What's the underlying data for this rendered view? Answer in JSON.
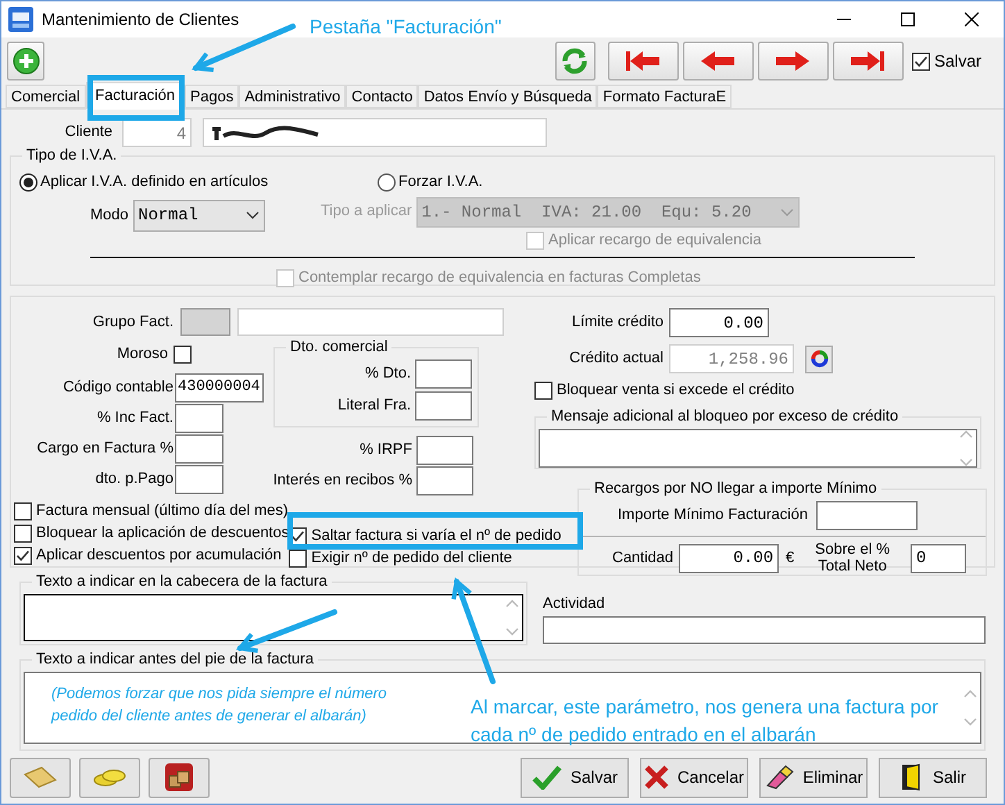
{
  "window": {
    "title": "Mantenimiento de Clientes"
  },
  "toolbar": {
    "salvar": {
      "label": "Salvar",
      "checked": true
    }
  },
  "tabs": [
    {
      "label": "Comercial",
      "selected": false
    },
    {
      "label": "Facturación",
      "selected": true
    },
    {
      "label": "Pagos",
      "selected": false
    },
    {
      "label": "Administrativo",
      "selected": false
    },
    {
      "label": "Contacto",
      "selected": false
    },
    {
      "label": "Datos Envío y Búsqueda",
      "selected": false
    },
    {
      "label": "Formato FacturaE",
      "selected": false
    }
  ],
  "cliente": {
    "label": "Cliente",
    "code": "4"
  },
  "iva": {
    "title": "Tipo de I.V.A.",
    "options": [
      {
        "label": "Aplicar I.V.A. definido en artículos",
        "selected": true
      },
      {
        "label": "Forzar I.V.A.",
        "selected": false
      }
    ],
    "modo": {
      "label": "Modo",
      "value": "Normal"
    },
    "tipo": {
      "label": "Tipo a aplicar",
      "value": "1.- Normal  IVA: 21.00  Equ: 5.20",
      "disabled": true
    },
    "recargo": {
      "label": "Aplicar recargo de equivalencia",
      "checked": false,
      "disabled": true
    },
    "contemplar": {
      "label": "Contemplar recargo de equivalencia en facturas Completas",
      "checked": false,
      "disabled": true
    }
  },
  "billing": {
    "grupo": {
      "label": "Grupo Fact."
    },
    "moroso": {
      "label": "Moroso",
      "checked": false
    },
    "codigo": {
      "label": "Código contable",
      "value": "430000004"
    },
    "inc": {
      "label": "% Inc Fact."
    },
    "cargo": {
      "label": "Cargo en Factura %"
    },
    "pago": {
      "label": "dto. p.Pago"
    },
    "dto_group": {
      "title": "Dto. comercial",
      "fields": [
        {
          "label": "% Dto."
        },
        {
          "label": "Literal Fra."
        }
      ]
    },
    "irpf": {
      "label": "% IRPF"
    },
    "interes": {
      "label": "Interés en recibos %"
    },
    "checks_left": [
      {
        "label": "Factura mensual (último día del mes)",
        "checked": false
      },
      {
        "label": "Bloquear la aplicación de descuentos",
        "checked": false
      },
      {
        "label": "Aplicar descuentos por acumulación",
        "checked": true
      }
    ],
    "checks_mid": [
      {
        "label": "Saltar factura si varía el nº de pedido",
        "checked": true
      },
      {
        "label": "Exigir nº de pedido del cliente",
        "checked": false
      }
    ]
  },
  "credit": {
    "limite": {
      "label": "Límite crédito",
      "value": "0.00"
    },
    "actual": {
      "label": "Crédito actual",
      "value": "1,258.96",
      "disabled": true
    },
    "bloquear": {
      "label": "Bloquear venta si excede el crédito",
      "checked": false
    },
    "mensaje": {
      "title": "Mensaje adicional al bloqueo por exceso de crédito"
    }
  },
  "recargos": {
    "title": "Recargos por NO llegar a importe Mínimo",
    "importe": {
      "label": "Importe Mínimo Facturación"
    },
    "cantidad": {
      "label": "Cantidad",
      "value": "0.00",
      "unit": "€"
    },
    "sobre": {
      "label": "Sobre el %\nTotal Neto",
      "value": "0"
    }
  },
  "texts": {
    "cabecera": {
      "title": "Texto a indicar en la cabecera de la factura"
    },
    "actividad": {
      "label": "Actividad"
    },
    "pie": {
      "title": "Texto a indicar antes del pie de la factura"
    }
  },
  "buttons": [
    {
      "label": "Salvar",
      "kind": "save"
    },
    {
      "label": "Cancelar",
      "kind": "cancel"
    },
    {
      "label": "Eliminar",
      "kind": "delete"
    },
    {
      "label": "Salir",
      "kind": "exit"
    }
  ],
  "annotations": {
    "tab_note": "Pestaña \"Facturación\"",
    "left_note": "(Podemos forzar que nos pida siempre el número pedido del cliente antes de generar el albarán)",
    "right_note": "Al marcar, este parámetro, nos genera una factura por cada nº de pedido entrado en el albarán"
  }
}
